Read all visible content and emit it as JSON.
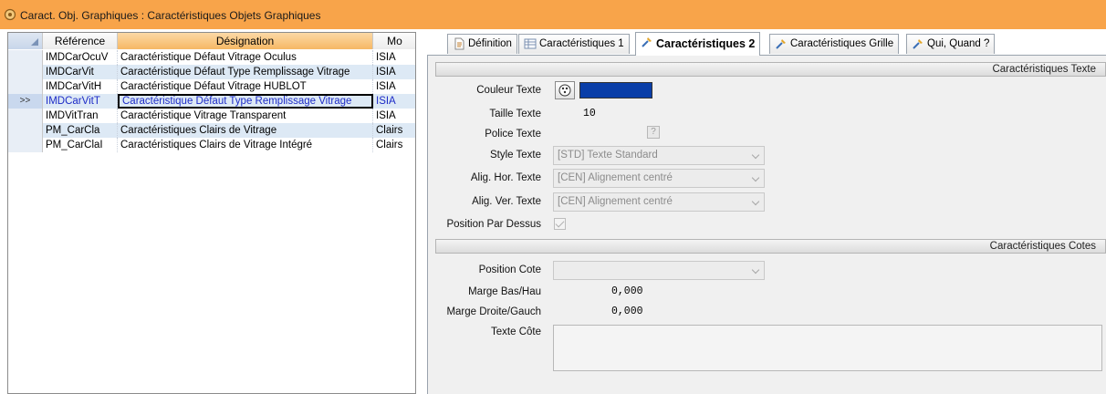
{
  "window": {
    "title": "Caract. Obj. Graphiques : Caractéristiques Objets Graphiques"
  },
  "grid": {
    "columns": [
      "Référence",
      "Désignation",
      "Mo"
    ],
    "rows": [
      {
        "ref": "IMDCarOcuV",
        "des": "Caractéristique Défaut Vitrage Oculus",
        "mo": "ISIA",
        "indicator": ""
      },
      {
        "ref": "IMDCarVit",
        "des": "Caractéristique Défaut Type Remplissage Vitrage",
        "mo": "ISIA",
        "indicator": ""
      },
      {
        "ref": "IMDCarVitH",
        "des": "Caractéristique Défaut Vitrage HUBLOT",
        "mo": "ISIA",
        "indicator": ""
      },
      {
        "ref": "IMDCarVitT",
        "des": "Caractéristique Défaut Type Remplissage Vitrage",
        "mo": "ISIA",
        "indicator": ">>"
      },
      {
        "ref": "IMDVitTran",
        "des": "Caractéristique Vitrage Transparent",
        "mo": "ISIA",
        "indicator": ""
      },
      {
        "ref": "PM_CarCla",
        "des": "Caractéristiques Clairs de Vitrage",
        "mo": "Clairs",
        "indicator": ""
      },
      {
        "ref": "PM_CarClaI",
        "des": "Caractéristiques Clairs de Vitrage Intégré",
        "mo": "Clairs",
        "indicator": ""
      }
    ]
  },
  "tabs": [
    "Définition",
    "Caractéristiques 1",
    "Caractéristiques 2",
    "Caractéristiques Grille",
    "Qui, Quand ?"
  ],
  "sections": {
    "texte": "Caractéristiques Texte",
    "cotes": "Caractéristiques Cotes"
  },
  "fields": {
    "couleur_label": "Couleur Texte",
    "couleur_value": "#0a3ea8",
    "taille_label": "Taille Texte",
    "taille_value": "10",
    "police_label": "Police Texte",
    "police_btn": "?",
    "style_label": "Style Texte",
    "style_value": "[STD] Texte Standard",
    "alig_hor_label": "Alig. Hor. Texte",
    "alig_hor_value": "[CEN] Alignement centré",
    "alig_ver_label": "Alig. Ver. Texte",
    "alig_ver_value": "[CEN] Alignement centré",
    "position_dessus_label": "Position Par Dessus",
    "position_cote_label": "Position Cote",
    "position_cote_value": "",
    "marge_bas_label": "Marge Bas/Hau",
    "marge_bas_value": "0,000",
    "marge_droite_label": "Marge Droite/Gauch",
    "marge_droite_value": "0,000",
    "texte_cote_label": "Texte Côte"
  },
  "colors": {
    "titlebar": "#f8a44a",
    "selected_header": "#f6b864",
    "alt_row": "#dde9f5",
    "selected_text": "#1d2bc7"
  }
}
